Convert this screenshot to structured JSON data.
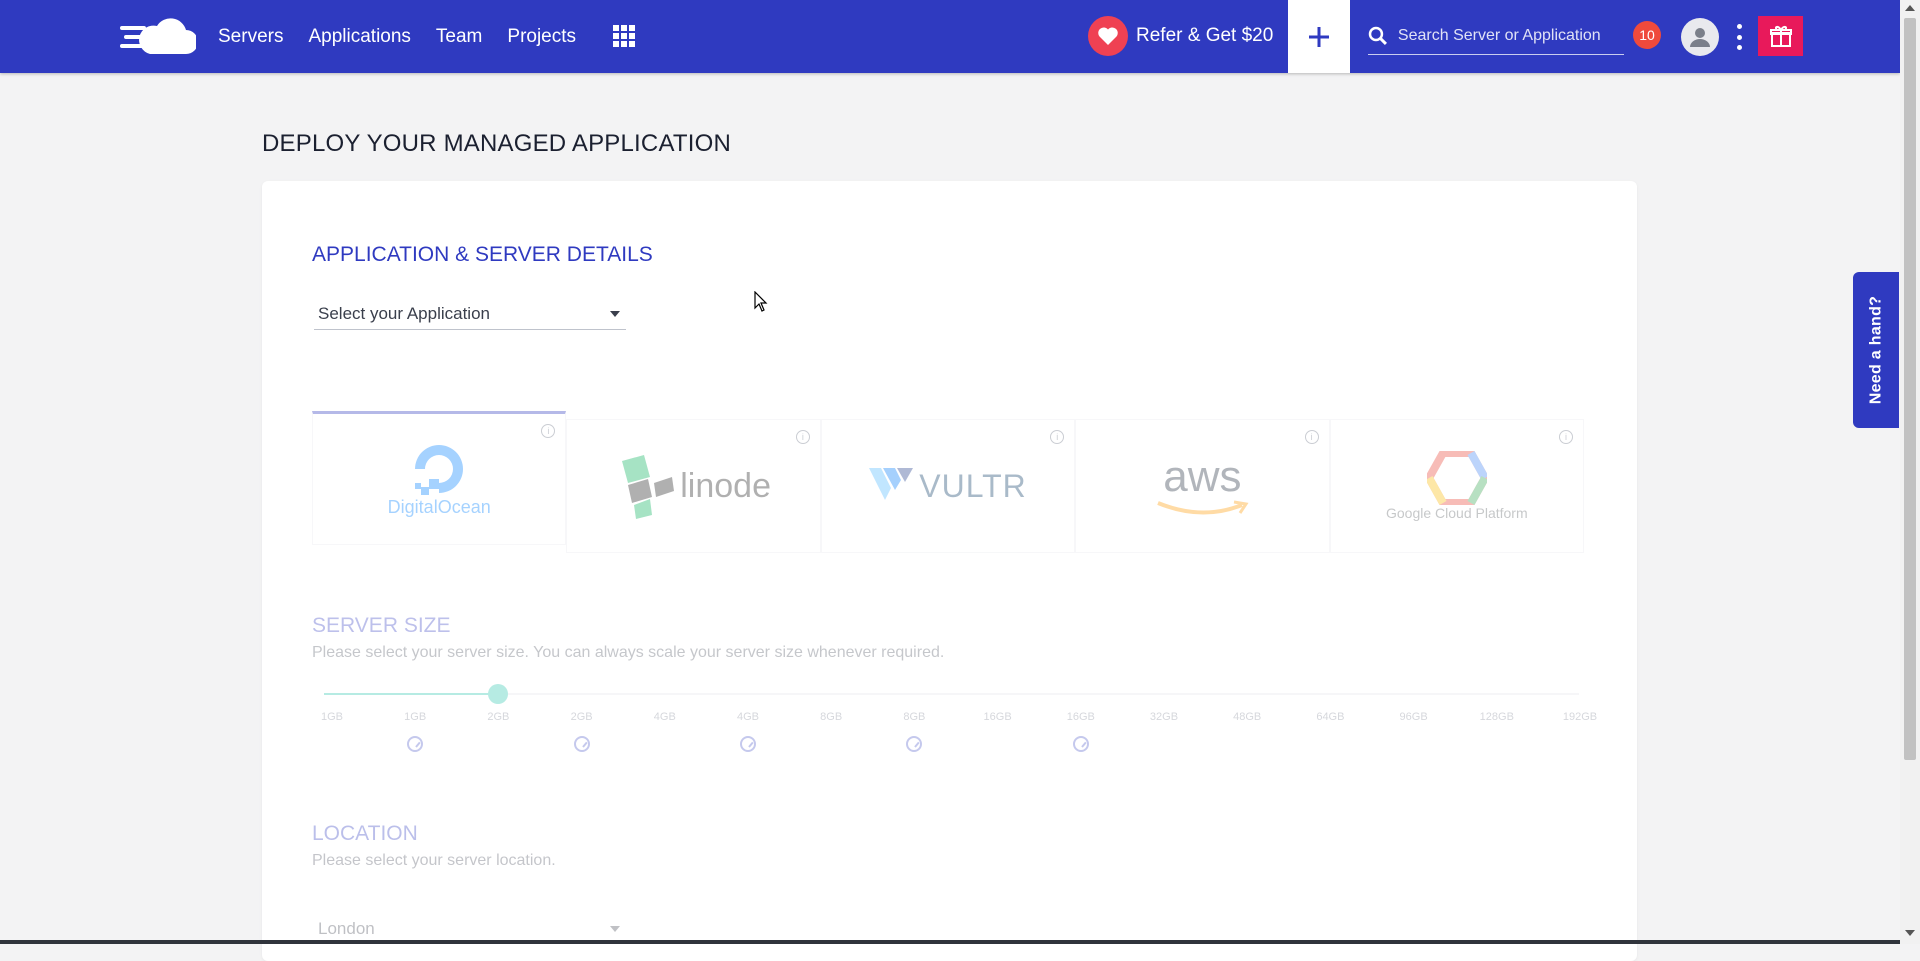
{
  "nav": {
    "items": [
      "Servers",
      "Applications",
      "Team",
      "Projects"
    ],
    "refer_label": "Refer & Get $20",
    "search_placeholder": "Search Server or Application",
    "notification_count": "10"
  },
  "page": {
    "title": "DEPLOY YOUR MANAGED APPLICATION"
  },
  "app_section": {
    "title": "APPLICATION & SERVER DETAILS",
    "select_label": "Select your Application"
  },
  "providers": [
    {
      "name": "DigitalOcean",
      "icon": "digitalocean-logo",
      "selected": true
    },
    {
      "name": "linode",
      "icon": "linode-logo",
      "selected": false
    },
    {
      "name": "VULTR",
      "icon": "vultr-logo",
      "selected": false
    },
    {
      "name": "aws",
      "icon": "aws-logo",
      "selected": false
    },
    {
      "name": "Google Cloud Platform",
      "icon": "google-cloud-logo",
      "selected": false
    }
  ],
  "server_size": {
    "title": "SERVER SIZE",
    "description": "Please select your server size. You can always scale your server size whenever required.",
    "ticks": [
      "1GB",
      "1GB",
      "2GB",
      "2GB",
      "4GB",
      "4GB",
      "8GB",
      "8GB",
      "16GB",
      "16GB",
      "32GB",
      "48GB",
      "64GB",
      "96GB",
      "128GB",
      "192GB"
    ],
    "selected_index": 2
  },
  "location": {
    "title": "LOCATION",
    "description": "Please select your server location.",
    "selected": "London"
  },
  "help": {
    "label": "Need a hand?"
  },
  "colors": {
    "brand": "#2f3ac0",
    "accent": "#19c1a8",
    "gift": "#e8195b",
    "badge": "#ef4a3c"
  }
}
